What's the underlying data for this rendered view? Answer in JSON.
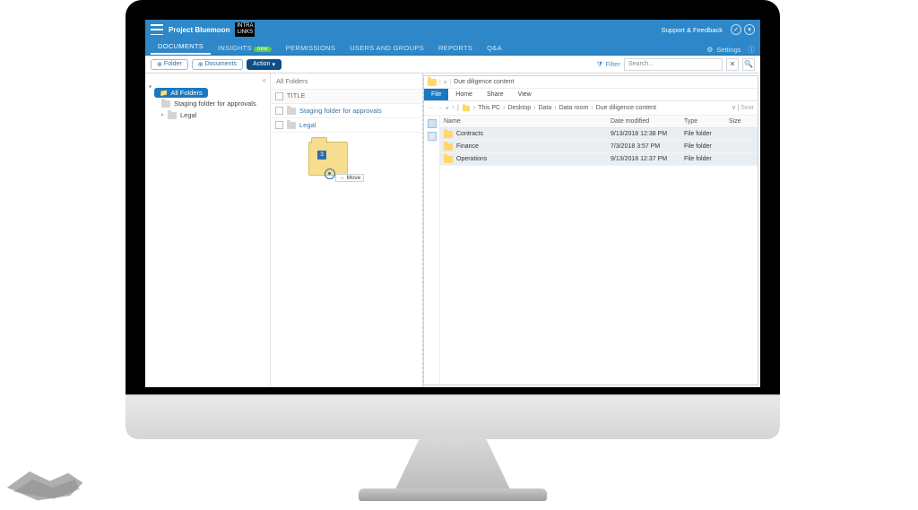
{
  "topbar": {
    "project_label": "Project Bluemoon",
    "brand_line1": "INTRA",
    "brand_line2": "LINKS",
    "support": "Support & Feedback"
  },
  "nav": {
    "tabs": [
      "DOCUMENTS",
      "INSIGHTS",
      "PERMISSIONS",
      "USERS AND GROUPS",
      "REPORTS",
      "Q&A"
    ],
    "new_badge": "new",
    "settings": "Settings"
  },
  "toolbar": {
    "add_folder": "Folder",
    "add_documents": "Documents",
    "action": "Action",
    "filter": "Filter",
    "search_placeholder": "Search..."
  },
  "tree": {
    "root": "All Folders",
    "items": [
      "Staging folder for approvals",
      "Legal"
    ]
  },
  "mid": {
    "header": "All Folders",
    "col_title": "TITLE",
    "rows": [
      "Staging folder for approvals",
      "Legal"
    ],
    "drag_count": "3",
    "move_tip": "Move"
  },
  "explorer": {
    "window_title": "Due diligence content",
    "tabs": [
      "File",
      "Home",
      "Share",
      "View"
    ],
    "breadcrumbs": [
      "This PC",
      "Desktop",
      "Data",
      "Data room",
      "Due diligence content"
    ],
    "search_hint": "Sear",
    "columns": {
      "name": "Name",
      "date": "Date modified",
      "type": "Type",
      "size": "Size"
    },
    "rows": [
      {
        "name": "Contracts",
        "date": "9/13/2018 12:38 PM",
        "type": "File folder",
        "size": ""
      },
      {
        "name": "Finance",
        "date": "7/3/2018 3:57 PM",
        "type": "File folder",
        "size": ""
      },
      {
        "name": "Operations",
        "date": "9/13/2018 12:37 PM",
        "type": "File folder",
        "size": ""
      }
    ]
  }
}
